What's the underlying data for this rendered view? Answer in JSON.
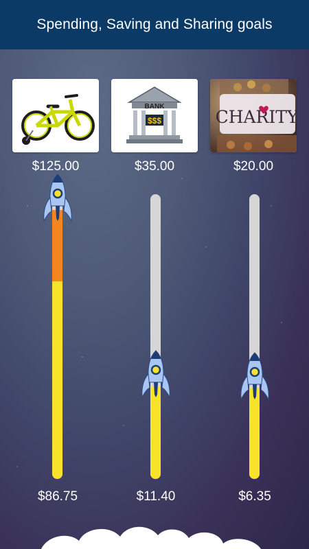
{
  "header": {
    "title": "Spending, Saving and Sharing goals"
  },
  "goals": [
    {
      "image_icon": "bicycle-picture",
      "goal_amount": "$125.00",
      "current_amount": "$86.75",
      "progress": 0.694,
      "pending": 0.25,
      "colors": {
        "saved": "#f8e22a",
        "pending": "#f5861f"
      }
    },
    {
      "image_icon": "bank-picture",
      "image_text": {
        "bank": "BANK",
        "sign": "$$$"
      },
      "goal_amount": "$35.00",
      "current_amount": "$11.40",
      "progress": 0.326
    },
    {
      "image_icon": "charity-jar-picture",
      "image_text": {
        "label": "CHARITY"
      },
      "goal_amount": "$20.00",
      "current_amount": "$6.35",
      "progress": 0.318
    }
  ],
  "colors": {
    "header": "#0c3a67",
    "track": "#d6d6d6",
    "progress": "#f8e22a",
    "rocket": "#a9c5f2"
  }
}
